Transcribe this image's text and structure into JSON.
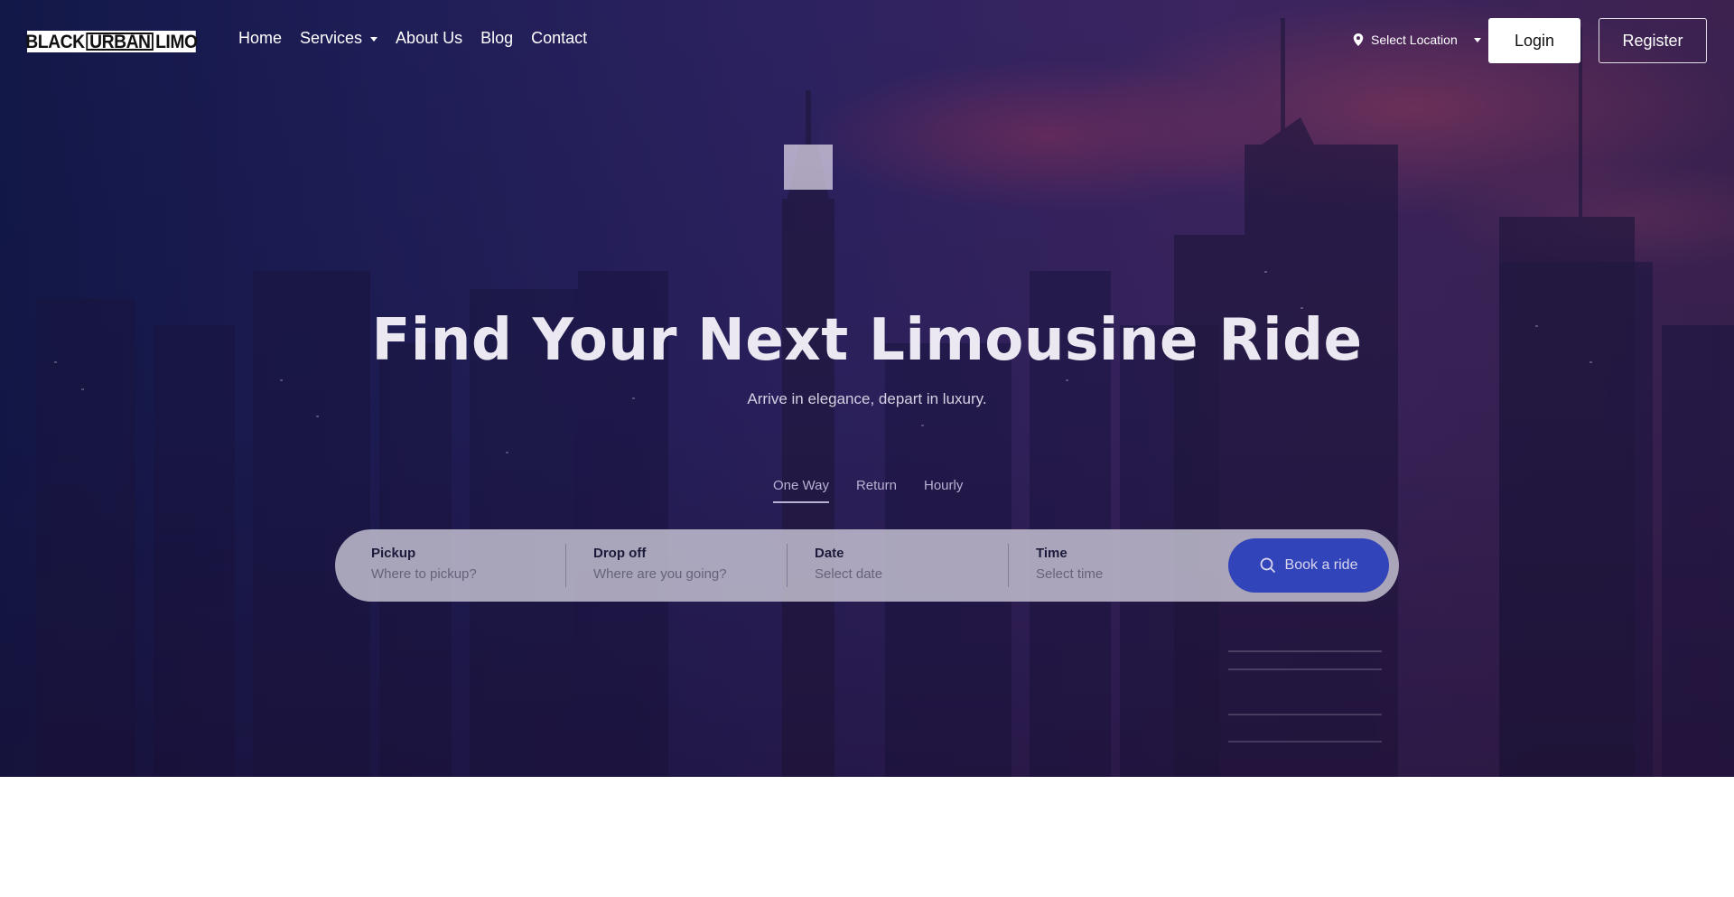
{
  "brand": {
    "logo_left": "BLACK",
    "logo_mid": "URBAN",
    "logo_right": "LIMO"
  },
  "nav": {
    "items": [
      {
        "label": "Home",
        "has_dropdown": false
      },
      {
        "label": "Services",
        "has_dropdown": true
      },
      {
        "label": "About Us",
        "has_dropdown": false
      },
      {
        "label": "Blog",
        "has_dropdown": false
      },
      {
        "label": "Contact",
        "has_dropdown": false
      }
    ]
  },
  "header_actions": {
    "location_label": "Select Location",
    "location_icon": "map-pin-icon",
    "login_label": "Login",
    "register_label": "Register"
  },
  "hero": {
    "title": "Find Your Next Limousine Ride",
    "subtitle": "Arrive in elegance, depart in luxury."
  },
  "booking": {
    "tabs": [
      {
        "label": "One Way",
        "active": true
      },
      {
        "label": "Return",
        "active": false
      },
      {
        "label": "Hourly",
        "active": false
      }
    ],
    "fields": [
      {
        "label": "Pickup",
        "placeholder": "Where to pickup?"
      },
      {
        "label": "Drop off",
        "placeholder": "Where are you going?"
      },
      {
        "label": "Date",
        "placeholder": "Select date"
      },
      {
        "label": "Time",
        "placeholder": "Select time"
      }
    ],
    "submit_label": "Book a ride",
    "submit_icon": "search-icon"
  },
  "colors": {
    "accent_button": "#283cb9",
    "hero_overlay": "#2c2260",
    "tab_text": "#b9b0d2"
  }
}
